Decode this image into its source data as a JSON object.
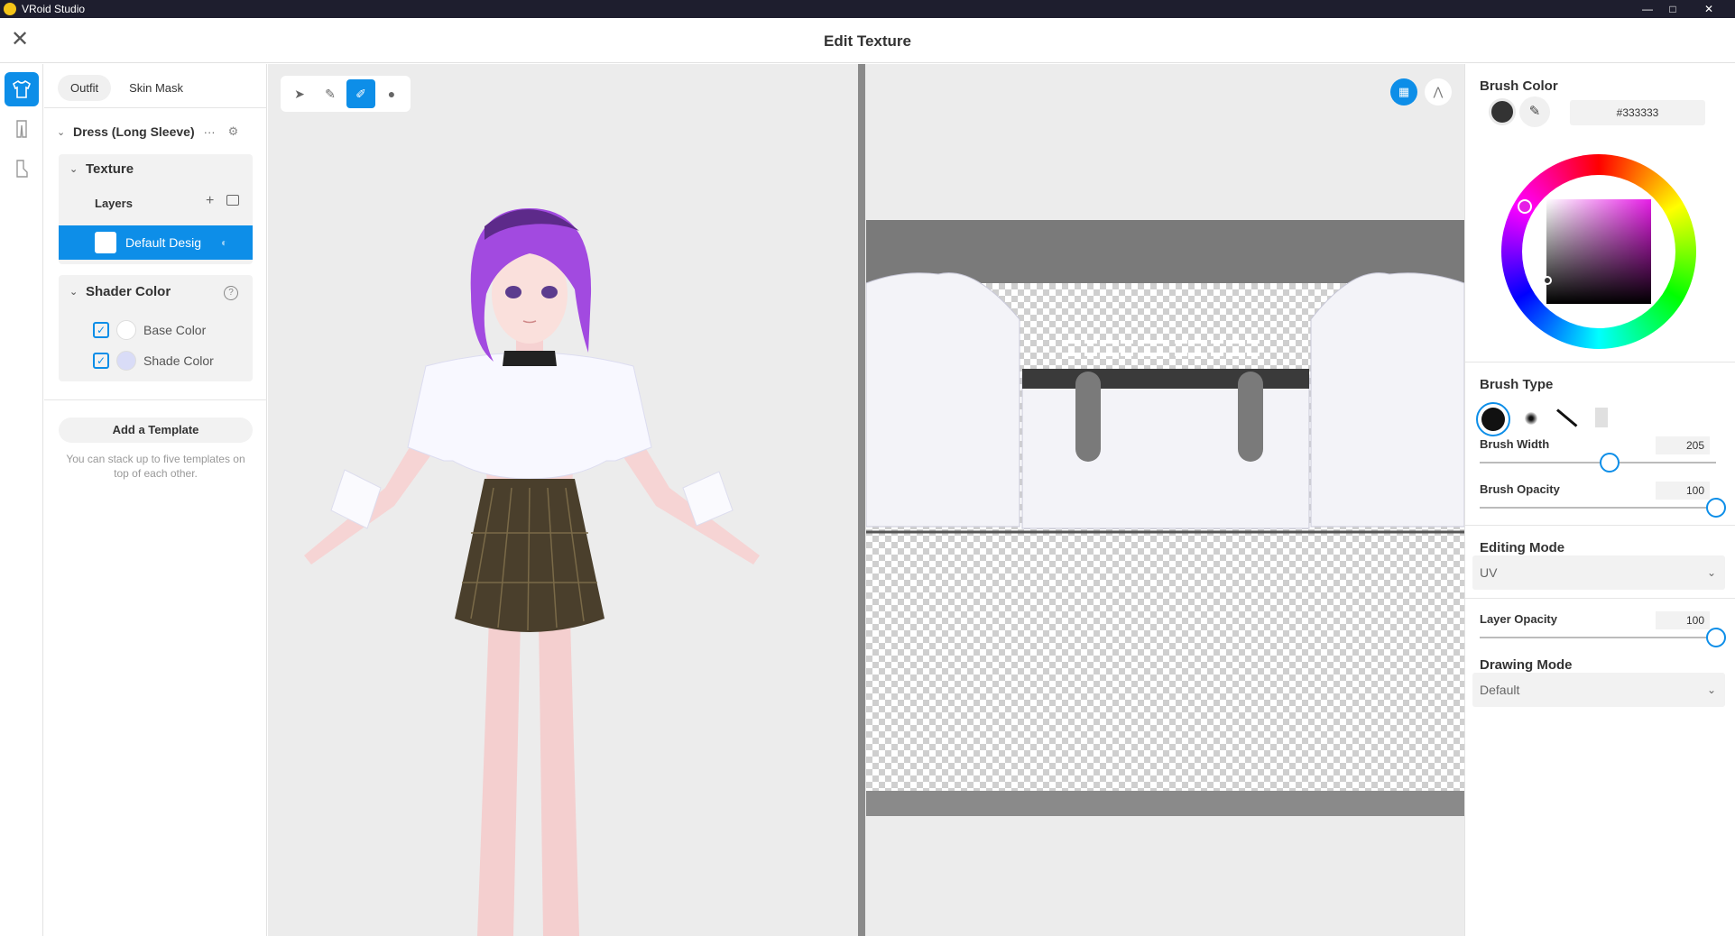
{
  "window": {
    "app_title": "VRoid Studio",
    "minimize": "—",
    "maximize": "□",
    "close": "✕"
  },
  "header": {
    "title": "Edit Texture",
    "close_glyph": "✕"
  },
  "rail": {
    "items": [
      "outfit-icon",
      "pants-icon",
      "shoes-icon"
    ]
  },
  "left_panel": {
    "tabs": [
      {
        "label": "Outfit",
        "active": true
      },
      {
        "label": "Skin Mask",
        "active": false
      }
    ],
    "item_name": "Dress (Long Sleeve)",
    "more_glyph": "···",
    "texture_label": "Texture",
    "layers_label": "Layers",
    "add_glyph": "+",
    "selected_layer": "Default Desig",
    "shader_label": "Shader Color",
    "help_glyph": "?",
    "base_color_label": "Base Color",
    "shade_color_label": "Shade Color",
    "base_color": "#ffffff",
    "shade_color": "#d9dcf7",
    "template_button": "Add a Template",
    "template_hint": "You can stack up to five templates on top of each other."
  },
  "tools": [
    "select-tool-icon",
    "pencil-tool-icon",
    "brush-tool-icon",
    "fill-tool-icon"
  ],
  "uv_controls": [
    "grid-toggle-icon",
    "mirror-toggle-icon"
  ],
  "right_panel": {
    "brush_color_label": "Brush Color",
    "brush_color_value": "#333333",
    "brush_type_label": "Brush Type",
    "brush_width_label": "Brush Width",
    "brush_width_value": "205",
    "brush_width_level": 0.55,
    "brush_opacity_label": "Brush Opacity",
    "brush_opacity_value": "100",
    "brush_opacity_level": 1.0,
    "editing_mode_label": "Editing Mode",
    "editing_mode_value": "UV",
    "layer_opacity_label": "Layer Opacity",
    "layer_opacity_value": "100",
    "layer_opacity_level": 1.0,
    "drawing_mode_label": "Drawing Mode",
    "drawing_mode_value": "Default",
    "dropdown_glyph": "⌄"
  },
  "colors": {
    "accent": "#0d8ee8",
    "brush": "#333333",
    "hair": "#a24ae0",
    "skirt": "#4a3f2c"
  }
}
